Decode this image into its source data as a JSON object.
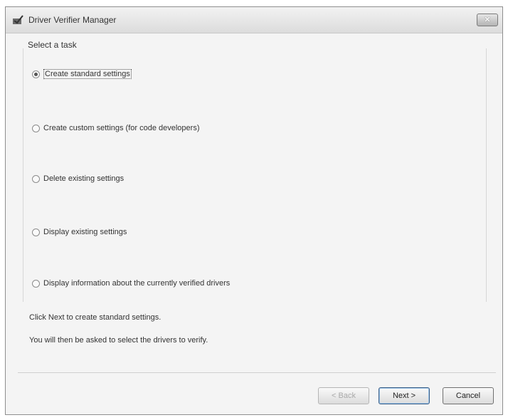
{
  "window": {
    "title": "Driver Verifier Manager",
    "close_glyph": "✕"
  },
  "task_group": {
    "label": "Select a task",
    "options": [
      {
        "label": "Create standard settings",
        "selected": true
      },
      {
        "label": "Create custom settings (for code developers)",
        "selected": false
      },
      {
        "label": "Delete existing settings",
        "selected": false
      },
      {
        "label": "Display existing settings",
        "selected": false
      },
      {
        "label": "Display information about the currently verified drivers",
        "selected": false
      }
    ]
  },
  "description": {
    "line1": "Click Next to create standard settings.",
    "line2": "You will then be asked to select the drivers to verify."
  },
  "buttons": {
    "back": "< Back",
    "next": "Next >",
    "cancel": "Cancel"
  }
}
